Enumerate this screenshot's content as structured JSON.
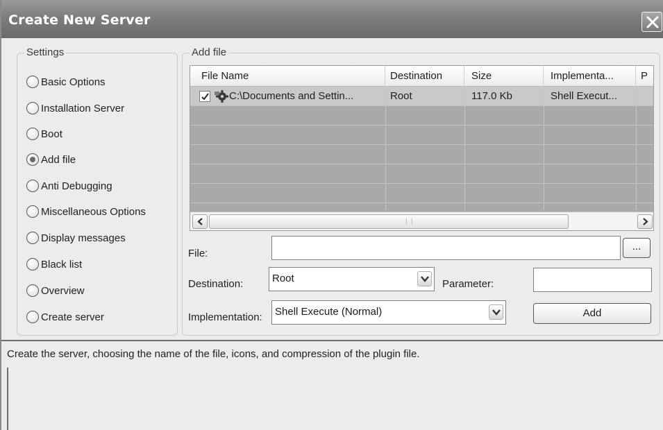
{
  "window": {
    "title": "Create New Server"
  },
  "settings": {
    "legend": "Settings",
    "options": [
      {
        "label": "Basic Options",
        "selected": false
      },
      {
        "label": "Installation Server",
        "selected": false
      },
      {
        "label": "Boot",
        "selected": false
      },
      {
        "label": "Add file",
        "selected": true
      },
      {
        "label": "Anti Debugging",
        "selected": false
      },
      {
        "label": "Miscellaneous Options",
        "selected": false
      },
      {
        "label": "Display messages",
        "selected": false
      },
      {
        "label": "Black list",
        "selected": false
      },
      {
        "label": "Overview",
        "selected": false
      },
      {
        "label": "Create server",
        "selected": false
      }
    ]
  },
  "add_file": {
    "legend": "Add file",
    "grid": {
      "columns": [
        "File Name",
        "Destination",
        "Size",
        "Implementa...",
        "P"
      ],
      "rows": [
        {
          "checked": true,
          "file_name": "C:\\Documents and Settin...",
          "destination": "Root",
          "size": "117.0 Kb",
          "implementation": "Shell Execut..."
        }
      ]
    },
    "file_label": "File:",
    "file_value": "",
    "browse_label": "...",
    "destination_label": "Destination:",
    "destination_value": "Root",
    "parameter_label": "Parameter:",
    "parameter_value": "",
    "implementation_label": "Implementation:",
    "implementation_value": "Shell Execute (Normal)",
    "add_label": "Add"
  },
  "status": {
    "text": "Create the server, choosing the name of the file, icons, and compression of the plugin file."
  },
  "colors": {
    "titlebar": "#7d7d7d",
    "window_bg": "#ececec",
    "grid_bg": "#a9a9a9",
    "selected_row": "#c9c9c9"
  },
  "icons": {
    "close": "close-icon",
    "checkbox_checked": "checkmark-icon",
    "file_type": "gear-file-icon",
    "scroll_left": "arrow-left-icon",
    "scroll_right": "arrow-right-icon",
    "dropdown": "chevron-down-icon"
  }
}
